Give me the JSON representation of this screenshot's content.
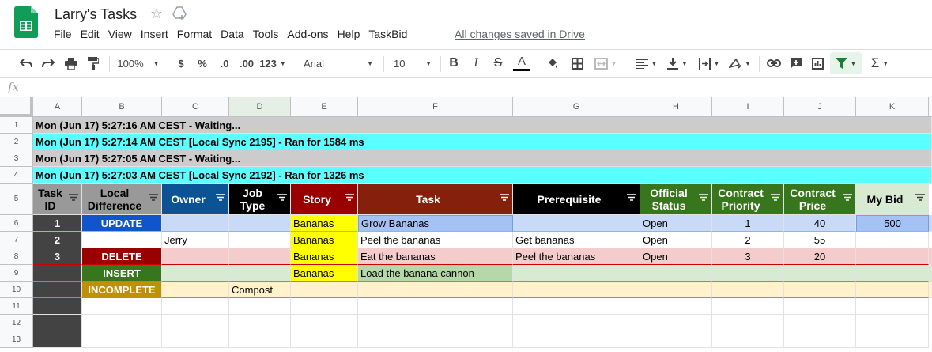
{
  "doc_title": "Larry's Tasks",
  "menu": [
    "File",
    "Edit",
    "View",
    "Insert",
    "Format",
    "Data",
    "Tools",
    "Add-ons",
    "Help",
    "TaskBid"
  ],
  "save_status": "All changes saved in Drive",
  "toolbar": {
    "zoom": "100%",
    "currency": "$",
    "percent": "%",
    "decrease_decimal": ".0",
    "increase_decimal": ".00",
    "more_formats": "123",
    "font": "Arial",
    "font_size": "10",
    "bold": "B",
    "italic": "I",
    "strike": "S",
    "text_color": "A",
    "sum": "Σ"
  },
  "formula_bar": {
    "icon": "fx",
    "value": ""
  },
  "columns": [
    "A",
    "B",
    "C",
    "D",
    "E",
    "F",
    "G",
    "H",
    "I",
    "J",
    "K"
  ],
  "row_numbers": [
    "1",
    "2",
    "3",
    "4",
    "5",
    "6",
    "7",
    "8",
    "9",
    "10",
    "11",
    "12",
    "13"
  ],
  "log_rows": [
    "Mon (Jun 17) 5:27:16 AM CEST - Waiting...",
    "Mon (Jun 17) 5:27:14 AM CEST [Local Sync 2195] - Ran for 1584 ms",
    "Mon (Jun 17) 5:27:05 AM CEST - Waiting...",
    "Mon (Jun 17) 5:27:03 AM CEST [Local Sync 2192] - Ran for 1326 ms"
  ],
  "header_row": {
    "task_id": "Task ID",
    "local_difference": "Local Difference",
    "owner": "Owner",
    "job_type": "Job Type",
    "story": "Story",
    "task": "Task",
    "prerequisite": "Prerequisite",
    "official_status": "Official Status",
    "contract_priority": "Contract Priority",
    "contract_price": "Contract Price",
    "my_bid": "My Bid"
  },
  "rows": [
    {
      "task_id": "1",
      "local_difference": "UPDATE",
      "owner": "",
      "job_type": "",
      "story": "Bananas",
      "task": "Grow Bananas",
      "prerequisite": "",
      "official_status": "Open",
      "contract_priority": "1",
      "contract_price": "40",
      "my_bid": "500"
    },
    {
      "task_id": "2",
      "local_difference": "",
      "owner": "Jerry",
      "job_type": "",
      "story": "Bananas",
      "task": "Peel the bananas",
      "prerequisite": "Get bananas",
      "official_status": "Open",
      "contract_priority": "2",
      "contract_price": "55",
      "my_bid": ""
    },
    {
      "task_id": "3",
      "local_difference": "DELETE",
      "owner": "",
      "job_type": "",
      "story": "Bananas",
      "task": "Eat the bananas",
      "prerequisite": "Peel the bananas",
      "official_status": "Open",
      "contract_priority": "3",
      "contract_price": "20",
      "my_bid": ""
    },
    {
      "task_id": "",
      "local_difference": "INSERT",
      "owner": "",
      "job_type": "",
      "story": "Bananas",
      "task": "Load the banana cannon",
      "prerequisite": "",
      "official_status": "",
      "contract_priority": "",
      "contract_price": "",
      "my_bid": ""
    },
    {
      "task_id": "",
      "local_difference": "INCOMPLETE",
      "owner": "",
      "job_type": "Compost",
      "story": "",
      "task": "",
      "prerequisite": "",
      "official_status": "",
      "contract_priority": "",
      "contract_price": "",
      "my_bid": ""
    }
  ],
  "colors": {
    "log_waiting": "#cccccc",
    "log_ran": "#5cffff",
    "update": "#1155cc",
    "delete": "#990000",
    "insert": "#38761d",
    "incomplete": "#bf9000",
    "story": "#ffff00",
    "task_header": "#85200c",
    "brand_green": "#0f9d58"
  }
}
